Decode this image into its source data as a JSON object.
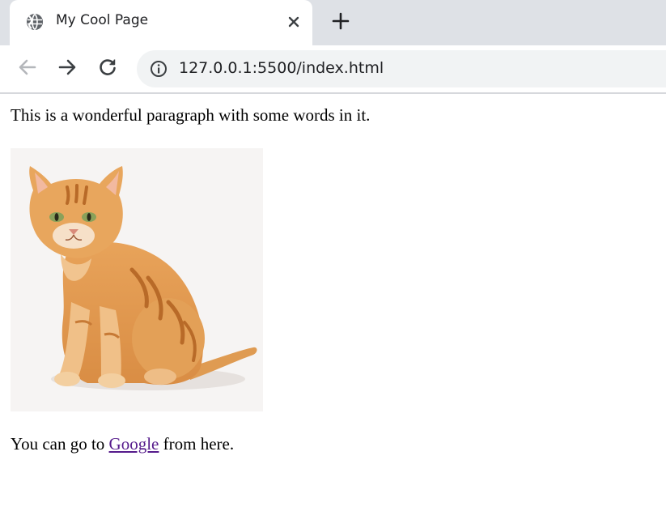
{
  "tab": {
    "title": "My Cool Page",
    "favicon": "globe-icon",
    "close": "close-icon",
    "new_tab": "plus-icon"
  },
  "toolbar": {
    "back": "arrow-left-icon",
    "forward": "arrow-right-icon",
    "reload": "reload-icon",
    "site_info": "info-icon",
    "url": "127.0.0.1:5500/index.html"
  },
  "page": {
    "paragraph1": "This is a wonderful paragraph with some words in it.",
    "image": "cat-photo",
    "paragraph2_before": "You can go to ",
    "link_text": "Google",
    "paragraph2_after": " from here."
  },
  "colors": {
    "tabstrip_bg": "#dee1e6",
    "omnibox_bg": "#f1f3f4",
    "visited_link": "#551a8b"
  }
}
